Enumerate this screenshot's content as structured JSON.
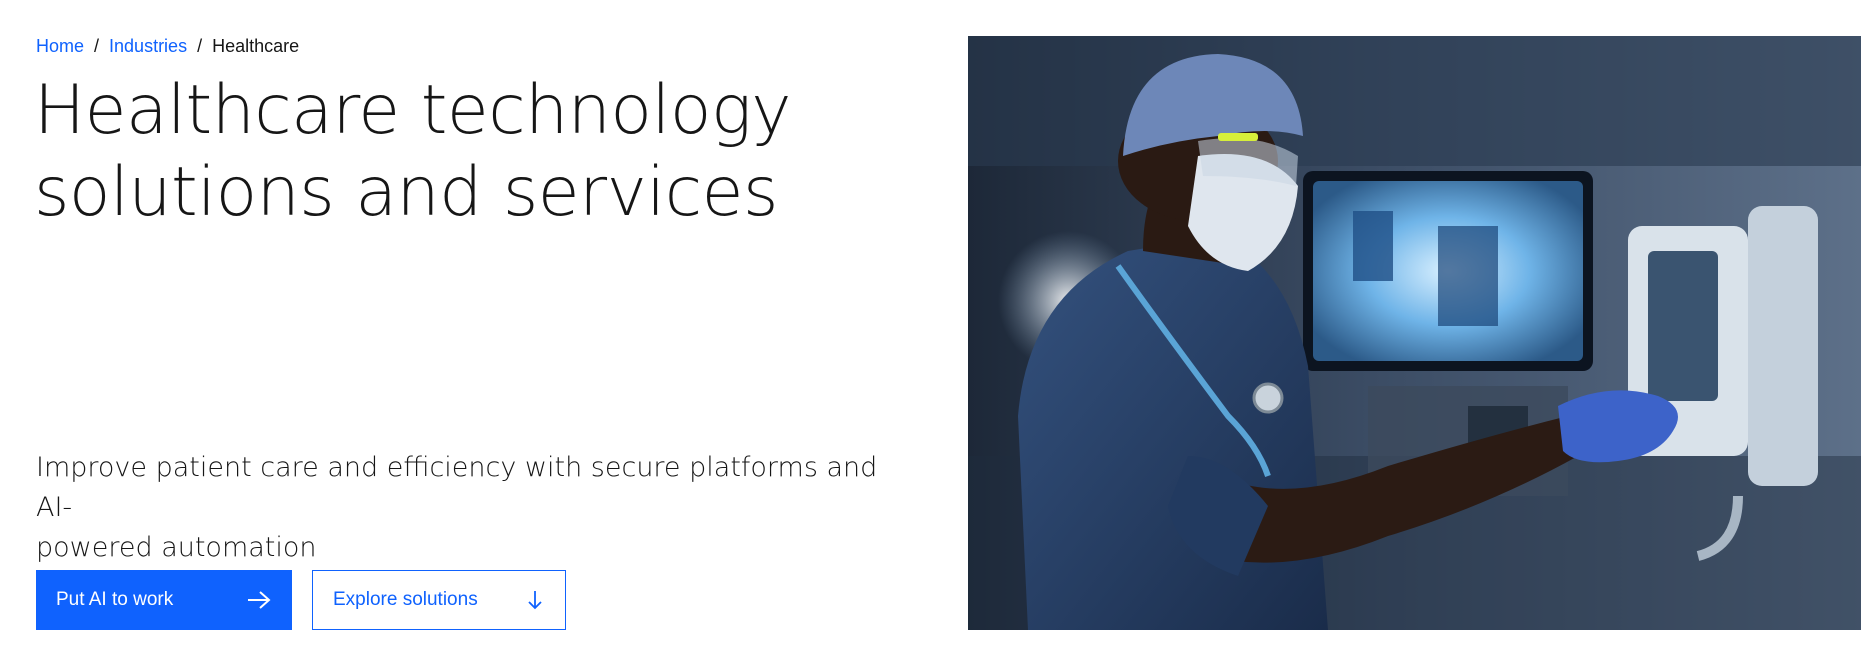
{
  "breadcrumb": {
    "separator": "/",
    "items": [
      {
        "label": "Home"
      },
      {
        "label": "Industries"
      }
    ],
    "current": "Healthcare"
  },
  "hero": {
    "title_line1": "Healthcare technology",
    "title_line2": "solutions and services",
    "lede_line1": "Improve patient care and efficiency with secure platforms and AI-",
    "lede_line2": "powered automation",
    "primary_button": {
      "label": "Put AI to work",
      "icon": "arrow-right-icon"
    },
    "secondary_button": {
      "label": "Explore solutions",
      "icon": "arrow-down-icon"
    },
    "image": {
      "subject": "clinician-at-medical-monitor"
    }
  },
  "colors": {
    "accent": "#0f62fe",
    "text": "#161616",
    "background": "#ffffff"
  }
}
